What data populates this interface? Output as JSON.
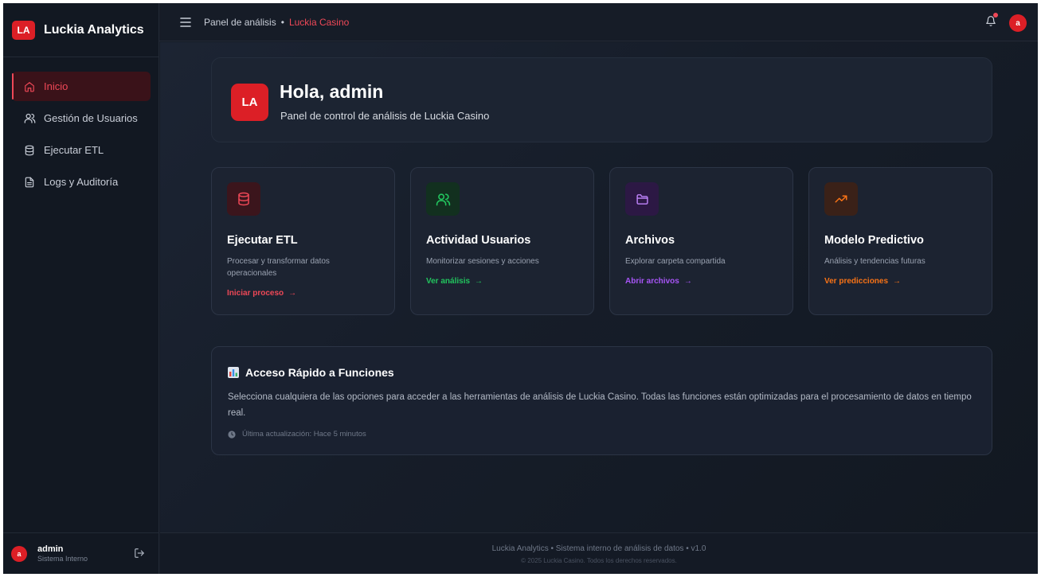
{
  "brand": {
    "logo": "LA",
    "name": "Luckia Analytics"
  },
  "sidebar": {
    "items": [
      {
        "label": "Inicio",
        "icon": "home-icon",
        "active": true
      },
      {
        "label": "Gestión de Usuarios",
        "icon": "users-icon",
        "active": false
      },
      {
        "label": "Ejecutar ETL",
        "icon": "database-icon",
        "active": false
      },
      {
        "label": "Logs y Auditoría",
        "icon": "file-text-icon",
        "active": false
      }
    ],
    "user": {
      "initial": "a",
      "name": "admin",
      "role": "Sistema Interno"
    }
  },
  "header": {
    "breadcrumb_root": "Panel de análisis",
    "breadcrumb_sep": "•",
    "breadcrumb_current": "Luckia Casino",
    "user_initial": "a"
  },
  "hero": {
    "logo": "LA",
    "title": "Hola, admin",
    "subtitle": "Panel de control de análisis de Luckia Casino"
  },
  "cards": [
    {
      "title": "Ejecutar ETL",
      "description": "Procesar y transformar datos operacionales",
      "link": "Iniciar proceso",
      "arrow": "→",
      "color": "#ef4857",
      "icon": "database-icon"
    },
    {
      "title": "Actividad Usuarios",
      "description": "Monitorizar sesiones y acciones",
      "link": "Ver análisis",
      "arrow": "→",
      "color": "#22c55e",
      "icon": "users-icon"
    },
    {
      "title": "Archivos",
      "description": "Explorar carpeta compartida",
      "link": "Abrir archivos",
      "arrow": "→",
      "color": "#a855f7",
      "icon": "folder-icon"
    },
    {
      "title": "Modelo Predictivo",
      "description": "Análisis y tendencias futuras",
      "link": "Ver predicciones",
      "arrow": "→",
      "color": "#f97316",
      "icon": "trending-up-icon"
    }
  ],
  "quick_access": {
    "title": "Acceso Rápido a Funciones",
    "text": "Selecciona cualquiera de las opciones para acceder a las herramientas de análisis de Luckia Casino. Todas las funciones están optimizadas para el procesamiento de datos en tiempo real.",
    "last_update": "Última actualización: Hace 5 minutos"
  },
  "footer": {
    "line1": "Luckia Analytics • Sistema interno de análisis de datos • v1.0",
    "line2": "© 2025 Luckia Casino. Todos los derechos reservados."
  }
}
